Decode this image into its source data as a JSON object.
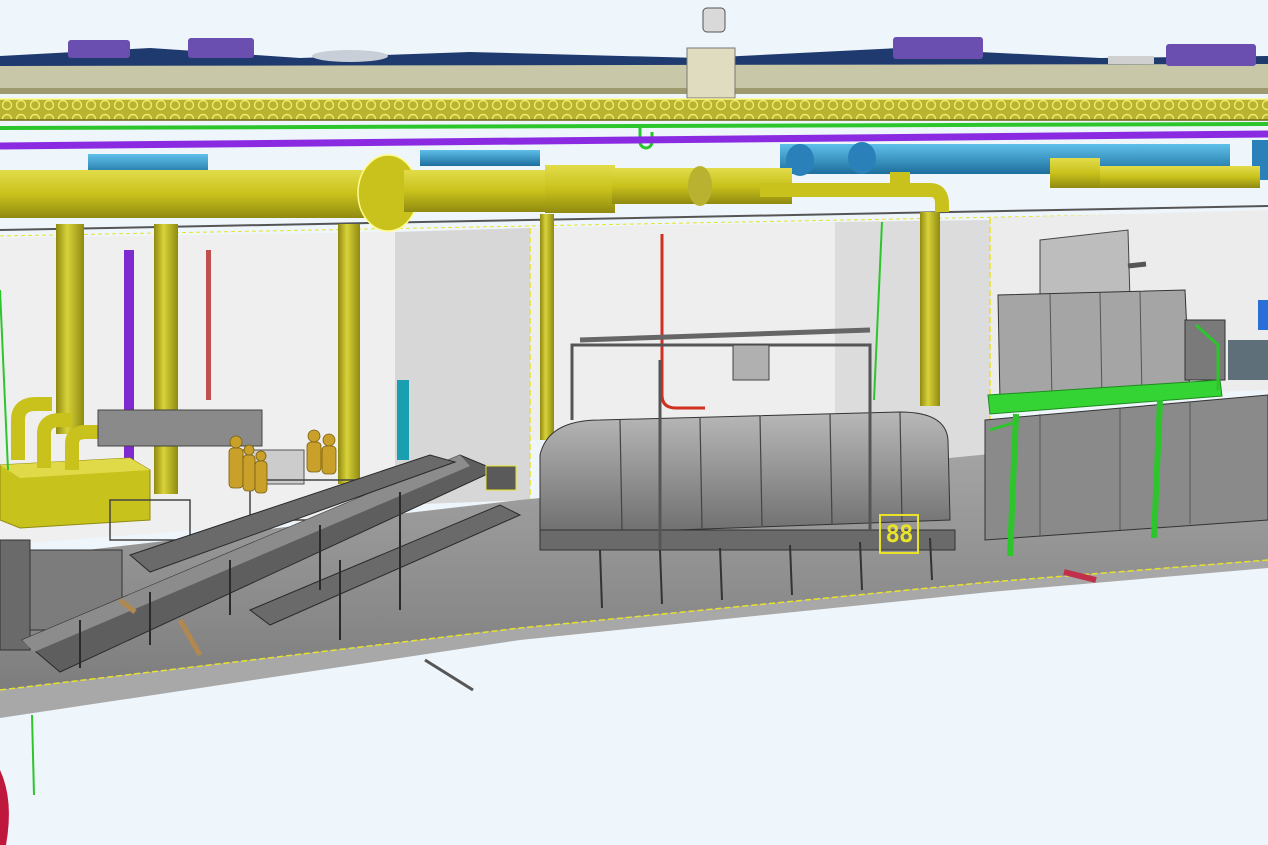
{
  "viewport": {
    "background": "#eef5fb",
    "palette": {
      "pipe_yellow": "#c9c21c",
      "pipe_yellow_dark": "#8f8a10",
      "pipe_purple": "#8a2be2",
      "duct_blue": "#2ea0d8",
      "roof_navy": "#1f3a6e",
      "roof_vent": "#6a4fb0",
      "platform_green": "#35d435",
      "wall_grey": "#e6e6e6",
      "equipment_grey": "#9a9a9a",
      "worker_ochre": "#c8a02a",
      "pipe_red": "#d03020"
    },
    "room_tag": "88",
    "components": {
      "roof": "roof-deck",
      "cable_tray": "cable-tray",
      "main_duct": "process-exhaust-duct",
      "conveyors": "inclined-belt-conveyors",
      "dryer": "tunnel-dryer",
      "oven": "cooking-oven",
      "platform": "service-platform",
      "workers": "operator-figures"
    }
  }
}
